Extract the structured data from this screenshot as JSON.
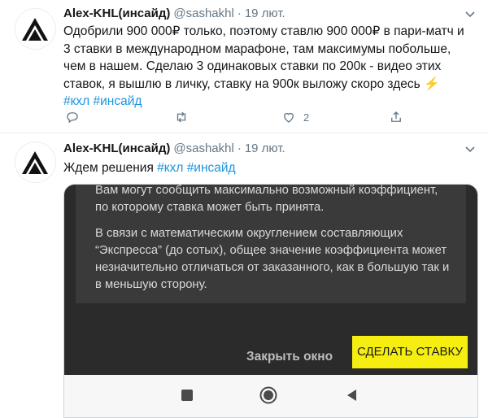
{
  "tweets": [
    {
      "author": {
        "name": "Alex-KHL(инсайд)",
        "handle": "@sashakhl"
      },
      "separator": "·",
      "date": "19 лют.",
      "text": "Одобрили 900 000₽ только, поэтому ставлю 900 000₽ в пари-матч и 3 ставки в международном марафоне, там максимумы побольше, чем в нашем. Сделаю 3 одинаковых ставки по 200к - видео этих ставок, я вышлю в личку, ставку на 900к выложу скоро здесь",
      "emoji": "⚡",
      "hashtags": [
        "#кхл",
        "#инсайд"
      ],
      "actions": {
        "likes": "2"
      }
    },
    {
      "author": {
        "name": "Alex-KHL(инсайд)",
        "handle": "@sashakhl"
      },
      "separator": "·",
      "date": "19 лют.",
      "text": "Ждем решения",
      "hashtags": [
        "#кхл",
        "#инсайд"
      ],
      "media": {
        "dialog_paragraph_1": "Вам могут сообщить максимально возможный коэффициент, по которому ставка может быть принята.",
        "dialog_paragraph_2": "В связи с математическим округлением составляющих “Экспресса” (до сотых), общее значение коэффициента может незначительно отличаться от заказанного, как в большую так и в меньшую сторону.",
        "close_button": "Закрыть окно",
        "bet_button": "СДЕЛАТЬ СТАВКУ"
      }
    }
  ],
  "colors": {
    "accent": "#1b95e0",
    "muted": "#657786",
    "bet_button": "#f5ee10"
  },
  "icons": [
    "logo-avatar-icon",
    "chevron-down-icon",
    "reply-icon",
    "retweet-icon",
    "like-icon",
    "share-icon",
    "nav-stop-icon",
    "nav-home-icon",
    "nav-back-icon"
  ]
}
